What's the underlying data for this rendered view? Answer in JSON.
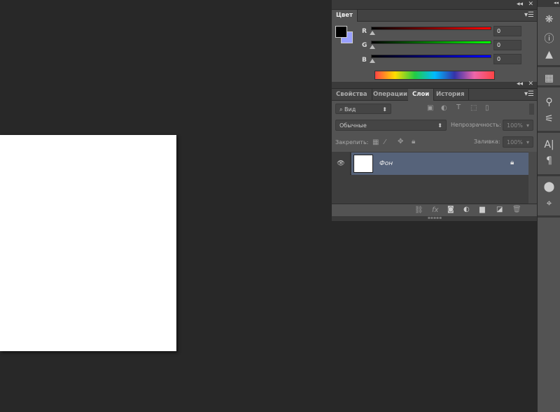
{
  "color_panel": {
    "tab": "Цвет",
    "channels": [
      {
        "label": "R",
        "value": "0",
        "color": "#ff0000"
      },
      {
        "label": "G",
        "value": "0",
        "color": "#00ff00"
      },
      {
        "label": "B",
        "value": "0",
        "color": "#0000ff"
      }
    ],
    "foreground": "#000000",
    "background": "#99a0ff"
  },
  "layers_panel": {
    "tabs": [
      "Свойства",
      "Операции",
      "Слои",
      "История"
    ],
    "active_tab": "Слои",
    "filter": "Вид",
    "blend_mode": "Обычные",
    "opacity_label": "Непрозрачность:",
    "opacity": "100%",
    "lock_label": "Закрепить:",
    "fill_label": "Заливка:",
    "fill": "100%",
    "layers": [
      {
        "name": "Фон",
        "locked": true,
        "visible": true
      }
    ]
  },
  "controls": {
    "collapse": "◂◂",
    "close": "✕",
    "menu": "▾☰"
  }
}
